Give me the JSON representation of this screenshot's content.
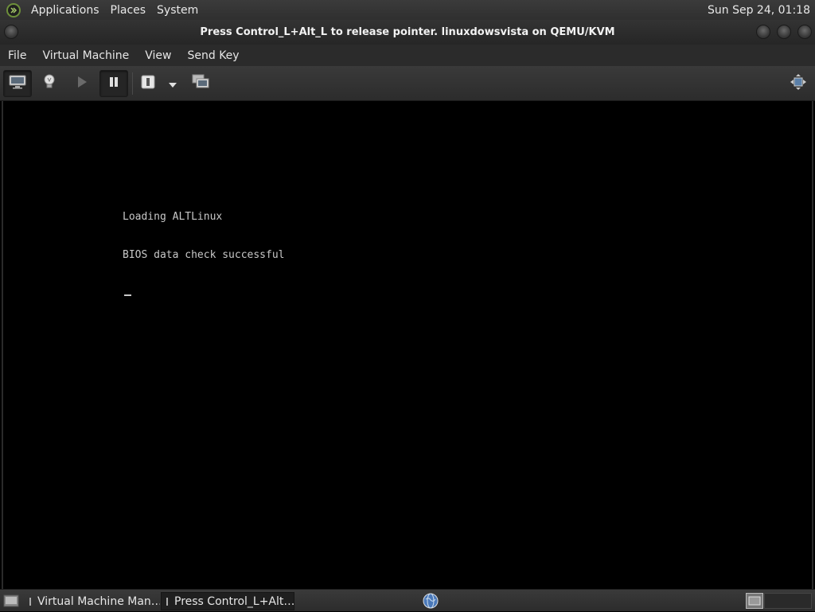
{
  "top_panel": {
    "menus": [
      "Applications",
      "Places",
      "System"
    ],
    "clock": "Sun Sep 24, 01:18"
  },
  "window": {
    "title": "Press Control_L+Alt_L to release pointer. linuxdowsvista on QEMU/KVM"
  },
  "menubar": {
    "items": [
      "File",
      "Virtual Machine",
      "View",
      "Send Key"
    ]
  },
  "toolbar": {
    "buttons": [
      "console-icon",
      "lightbulb-icon",
      "play-icon",
      "pause-icon",
      "power-icon",
      "dropdown-arrow-icon",
      "snapshots-icon",
      "fullscreen-icon"
    ]
  },
  "console": {
    "lines": [
      "Loading ALTLinux",
      "BIOS data check successful"
    ]
  },
  "taskbar": {
    "tasks": [
      {
        "label": "Virtual Machine Man…",
        "active": false
      },
      {
        "label": "Press Control_L+Alt…",
        "active": true
      }
    ]
  },
  "colors": {
    "panel": "#2f2f2f",
    "vm_background": "#000000",
    "console_text": "#c8c8c8"
  }
}
